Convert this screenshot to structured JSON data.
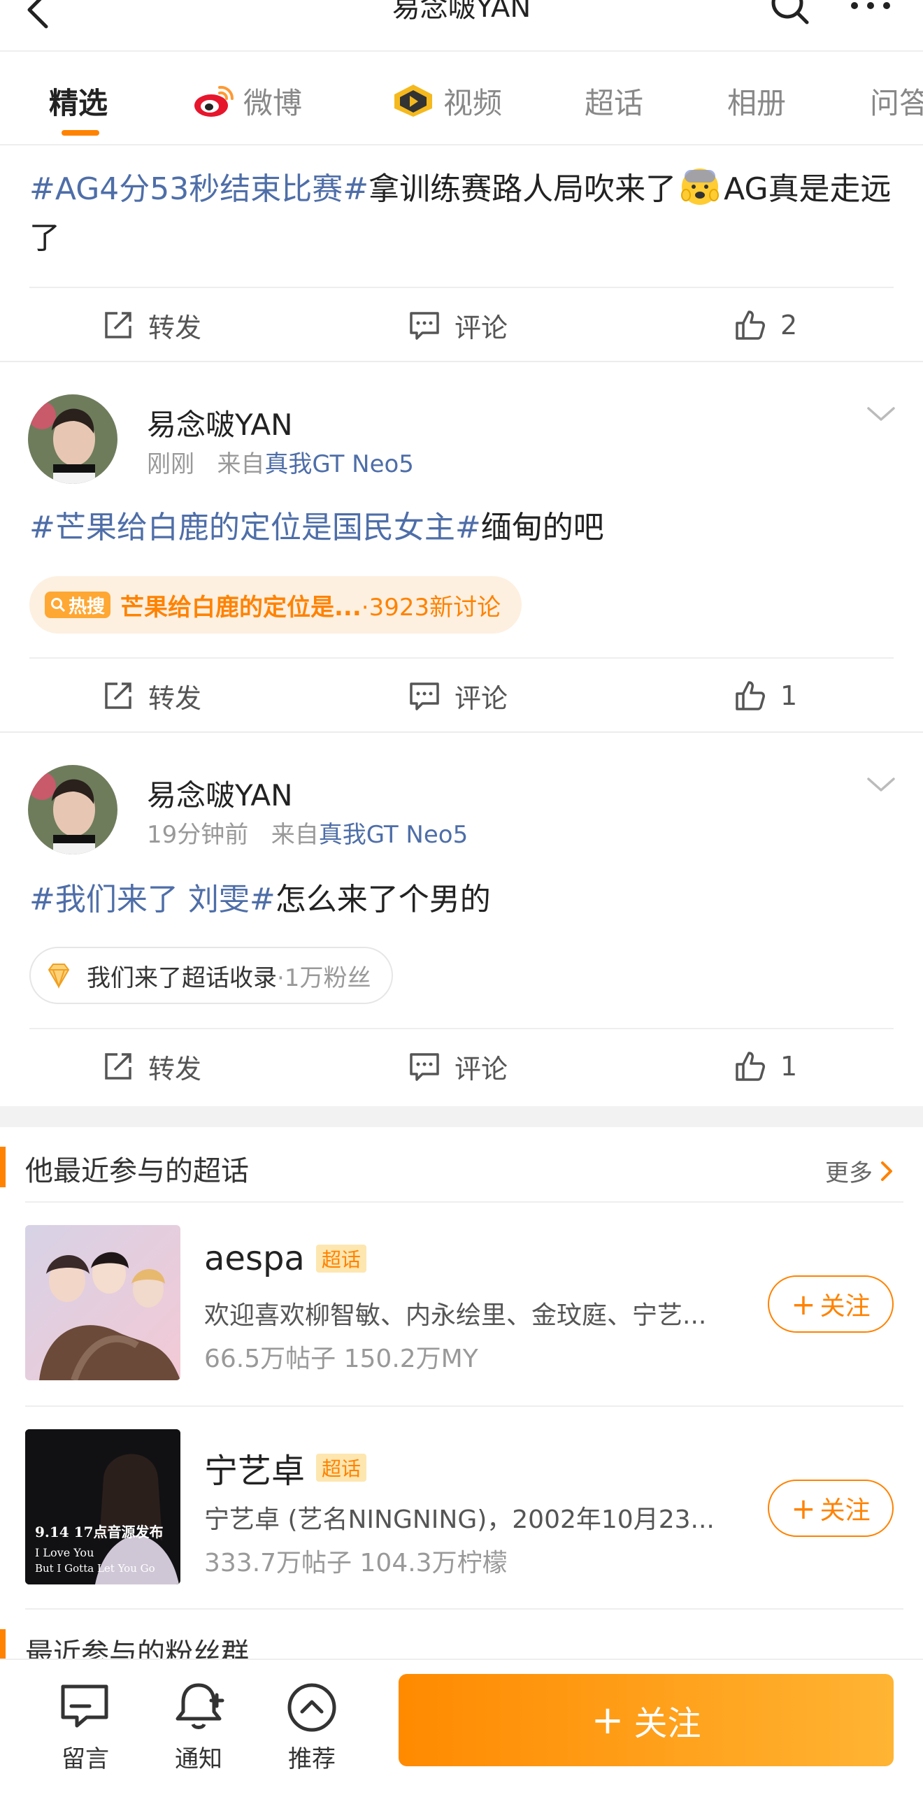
{
  "header": {
    "title": "易念啵YAN"
  },
  "tabs": [
    {
      "label": "精选"
    },
    {
      "label": "微博"
    },
    {
      "label": "视频"
    },
    {
      "label": "超话"
    },
    {
      "label": "相册"
    },
    {
      "label": "问答"
    }
  ],
  "posts": [
    {
      "text_tag": "#AG4分53秒结束比赛#",
      "text_body": "拿训练赛路人局吹来了",
      "text_tail": "AG真是走远了",
      "emoji": "fearful-face-emoji",
      "actions": {
        "repost": "转发",
        "comment": "评论",
        "like_count": "2"
      }
    },
    {
      "author": "易念啵YAN",
      "time": "刚刚",
      "from_label": "来自",
      "source": "真我GT Neo5",
      "text_tag": "#芒果给白鹿的定位是国民女主#",
      "text_body": "缅甸的吧",
      "hot_badge": "热搜",
      "hot_topic": "芒果给白鹿的定位是...",
      "hot_count": "·3923新讨论",
      "actions": {
        "repost": "转发",
        "comment": "评论",
        "like_count": "1"
      }
    },
    {
      "author": "易念啵YAN",
      "time": "19分钟前",
      "from_label": "来自",
      "source": "真我GT Neo5",
      "text_tag": "#我们来了 刘雯#",
      "text_body": "怎么来了个男的",
      "topic_label": "我们来了超话收录",
      "topic_count": "·1万粉丝",
      "actions": {
        "repost": "转发",
        "comment": "评论",
        "like_count": "1"
      }
    }
  ],
  "super_topics": {
    "title": "他最近参与的超话",
    "more": "更多",
    "items": [
      {
        "name": "aespa",
        "badge": "超话",
        "desc": "欢迎喜欢柳智敏、内永绘里、金玟庭、宁艺...",
        "stats": "66.5万帖子 150.2万MY",
        "follow": "关注"
      },
      {
        "name": "宁艺卓",
        "badge": "超话",
        "desc": "宁艺卓 (艺名NINGNING)，2002年10月23...",
        "stats": "333.7万帖子 104.3万柠檬",
        "follow": "关注",
        "poster_lines": [
          "9.14 17点音源发布",
          "I Love You",
          "But I Gotta Let You Go"
        ]
      }
    ]
  },
  "fan_groups": {
    "title": "最近参与的粉丝群"
  },
  "bottom_bar": {
    "message": "留言",
    "notify": "通知",
    "recommend": "推荐",
    "follow": "关注"
  },
  "colors": {
    "accent": "#ff8200",
    "link": "#4e6ea8"
  }
}
